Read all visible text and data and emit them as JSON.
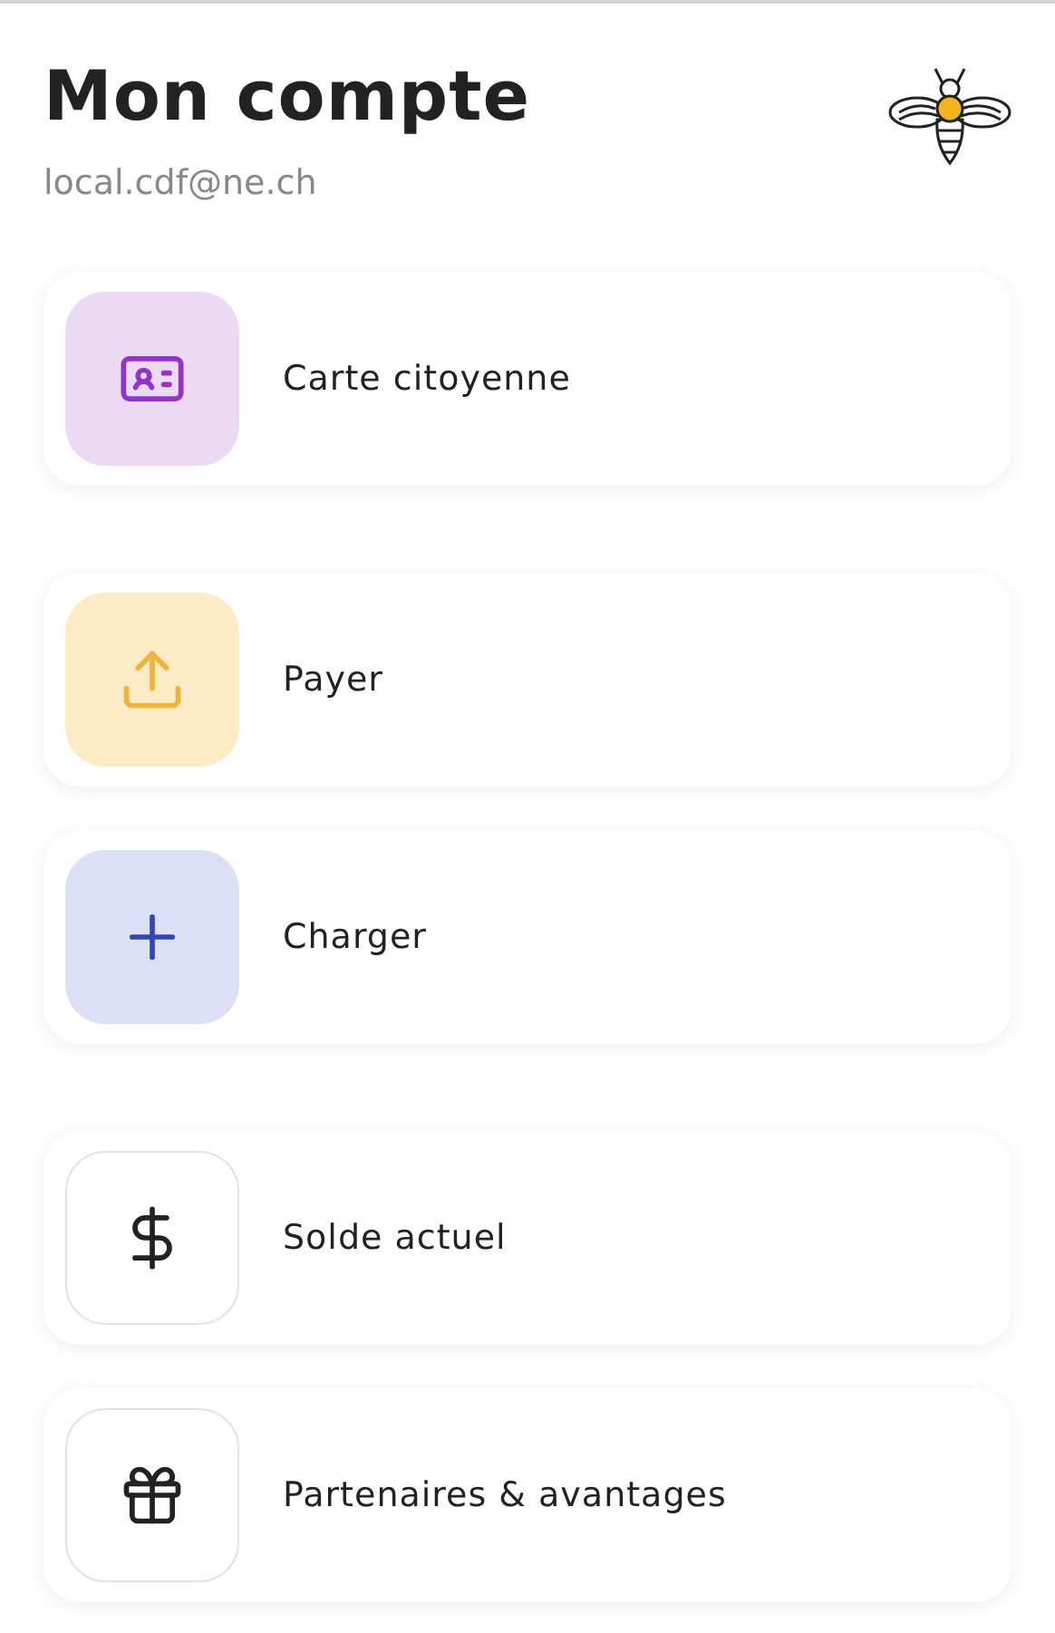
{
  "header": {
    "title": "Mon compte",
    "email": "local.cdf@ne.ch"
  },
  "sections": [
    {
      "items": [
        {
          "label": "Carte citoyenne",
          "kind": "id-card",
          "color": "#ecd9f3"
        }
      ]
    },
    {
      "items": [
        {
          "label": "Payer",
          "kind": "upload",
          "color": "#fdebc6"
        },
        {
          "label": "Charger",
          "kind": "plus",
          "color": "#dde0f4"
        }
      ]
    },
    {
      "items": [
        {
          "label": "Solde actuel",
          "kind": "dollar",
          "color": "#ffffff"
        },
        {
          "label": "Partenaires & avantages",
          "kind": "gift",
          "color": "#ffffff"
        }
      ]
    }
  ]
}
